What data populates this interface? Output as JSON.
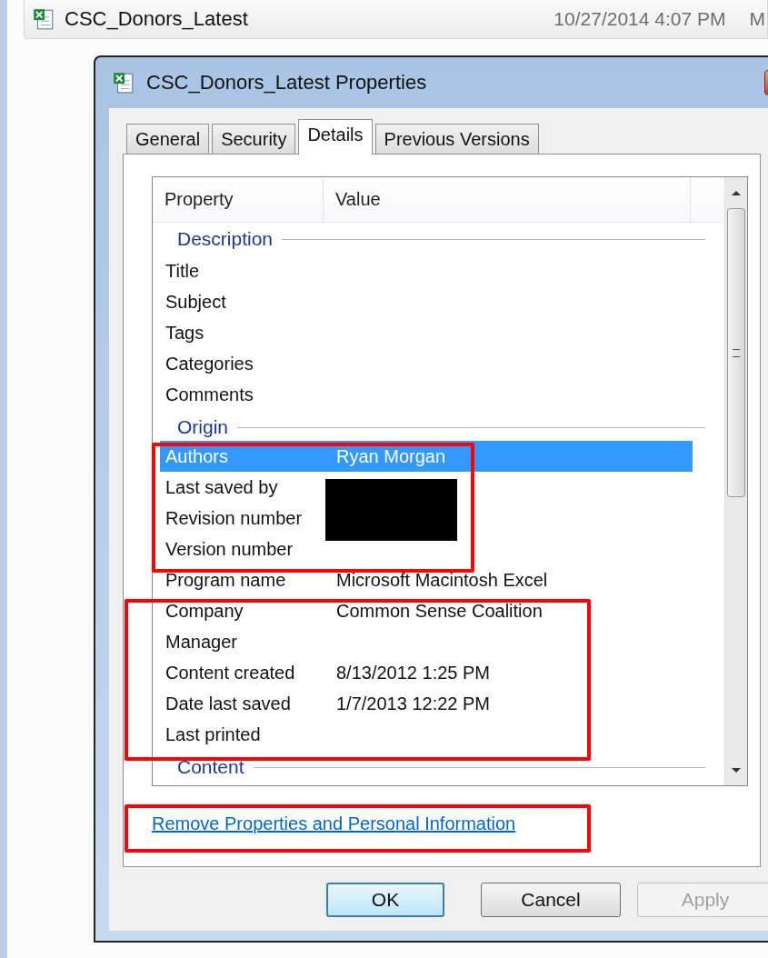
{
  "file_row": {
    "name": "CSC_Donors_Latest",
    "modified": "10/27/2014 4:07 PM",
    "column_3": "M"
  },
  "dialog": {
    "title": "CSC_Donors_Latest Properties",
    "tabs": [
      {
        "label": "General",
        "selected": false
      },
      {
        "label": "Security",
        "selected": false
      },
      {
        "label": "Details",
        "selected": true
      },
      {
        "label": "Previous Versions",
        "selected": false
      }
    ],
    "list": {
      "columns": [
        "Property",
        "Value"
      ],
      "groups": [
        {
          "label": "Description",
          "rows": [
            {
              "property": "Title",
              "selected": false
            },
            {
              "property": "Subject",
              "selected": false
            },
            {
              "property": "Tags",
              "selected": false
            },
            {
              "property": "Categories",
              "selected": false
            },
            {
              "property": "Comments",
              "selected": false
            }
          ]
        },
        {
          "label": "Origin",
          "rows": [
            {
              "property": "Authors",
              "value": "Ryan Morgan",
              "selected": true
            },
            {
              "property": "Last saved by",
              "selected": false
            },
            {
              "property": "Revision number",
              "selected": false
            },
            {
              "property": "Version number",
              "selected": false
            },
            {
              "property": "Program name",
              "value": "Microsoft Macintosh Excel",
              "selected": false
            },
            {
              "property": "Company",
              "value": "Common Sense Coalition",
              "selected": false
            },
            {
              "property": "Manager",
              "selected": false
            },
            {
              "property": "Content created",
              "value": "8/13/2012 1:25 PM",
              "selected": false
            },
            {
              "property": "Date last saved",
              "value": "1/7/2013 12:22 PM",
              "selected": false
            },
            {
              "property": "Last printed",
              "selected": false
            }
          ]
        },
        {
          "label": "Content"
        }
      ]
    },
    "link": "Remove Properties and Personal Information",
    "buttons": [
      {
        "label": "OK",
        "default": true,
        "disabled": false
      },
      {
        "label": "Cancel",
        "default": false,
        "disabled": false
      },
      {
        "label": "Apply",
        "default": false,
        "disabled": true
      }
    ]
  }
}
